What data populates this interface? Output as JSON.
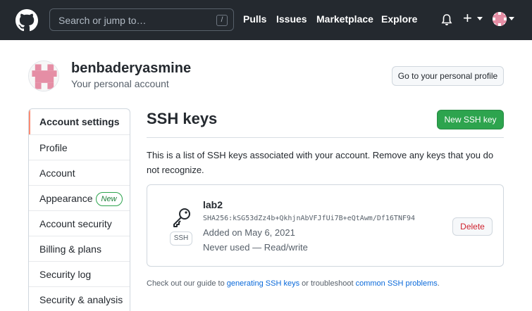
{
  "header": {
    "search_placeholder": "Search or jump to…",
    "search_shortcut": "/",
    "nav": [
      "Pulls",
      "Issues",
      "Marketplace",
      "Explore"
    ],
    "plus": "+"
  },
  "profile": {
    "username": "benbaderyasmine",
    "subtitle": "Your personal account",
    "profile_button": "Go to your personal profile"
  },
  "sidebar": {
    "items": [
      {
        "label": "Account settings"
      },
      {
        "label": "Profile"
      },
      {
        "label": "Account"
      },
      {
        "label": "Appearance",
        "badge": "New"
      },
      {
        "label": "Account security"
      },
      {
        "label": "Billing & plans"
      },
      {
        "label": "Security log"
      },
      {
        "label": "Security & analysis"
      }
    ]
  },
  "main": {
    "title": "SSH keys",
    "new_key_button": "New SSH key",
    "intro": "This is a list of SSH keys associated with your account. Remove any keys that you do not recognize.",
    "key": {
      "name": "lab2",
      "type_label": "SSH",
      "fingerprint": "SHA256:kSG53dZz4b+QkhjnAbVFJfUi7B+eQtAwm/Df16TNF94",
      "added": "Added on May 6, 2021",
      "usage": "Never used — Read/write",
      "delete_button": "Delete"
    },
    "footer": {
      "prefix": "Check out our guide to ",
      "link1": "generating SSH keys",
      "middle": " or troubleshoot ",
      "link2": "common SSH problems",
      "suffix": "."
    }
  },
  "colors": {
    "header_bg": "#24292f",
    "primary_green": "#2da44e",
    "danger_red": "#cf222e",
    "link_blue": "#0969da",
    "avatar_pink": "#e58ea5"
  }
}
